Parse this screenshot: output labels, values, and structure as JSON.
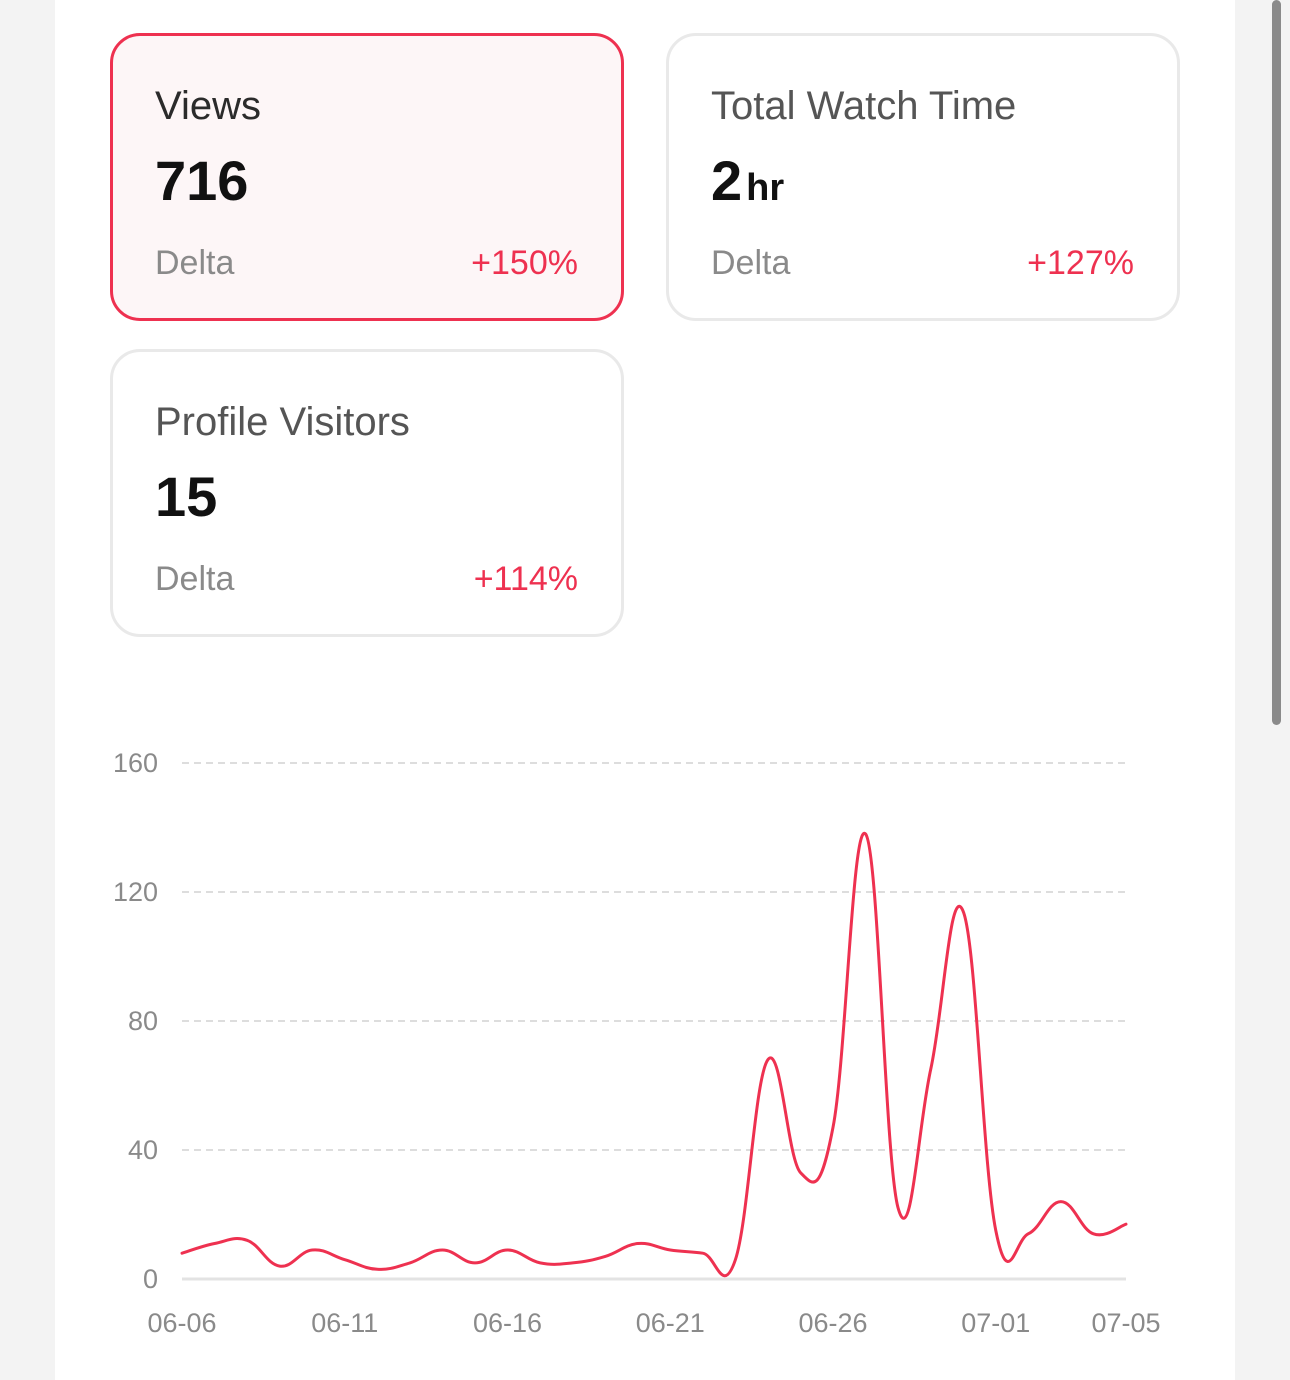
{
  "cards": [
    {
      "title": "Views",
      "value": "716",
      "unit": "",
      "delta_label": "Delta",
      "delta_value": "+150%",
      "selected": true
    },
    {
      "title": "Total Watch Time",
      "value": "2",
      "unit": "hr",
      "delta_label": "Delta",
      "delta_value": "+127%",
      "selected": false
    },
    {
      "title": "Profile Visitors",
      "value": "15",
      "unit": "",
      "delta_label": "Delta",
      "delta_value": "+114%",
      "selected": false
    }
  ],
  "colors": {
    "accent": "#ee3150",
    "grid": "#dddddd",
    "axis": "#e3e3e3",
    "tick_text": "#8a8a8a"
  },
  "chart_data": {
    "type": "line",
    "title": "",
    "xlabel": "",
    "ylabel": "",
    "ylim": [
      0,
      160
    ],
    "yticks": [
      0,
      40,
      80,
      120,
      160
    ],
    "xtick_labels": [
      "06-06",
      "06-11",
      "06-16",
      "06-21",
      "06-26",
      "07-01",
      "07-05"
    ],
    "grid": true,
    "x": [
      "06-06",
      "06-07",
      "06-08",
      "06-09",
      "06-10",
      "06-11",
      "06-12",
      "06-13",
      "06-14",
      "06-15",
      "06-16",
      "06-17",
      "06-18",
      "06-19",
      "06-20",
      "06-21",
      "06-22",
      "06-23",
      "06-24",
      "06-25",
      "06-26",
      "06-27",
      "06-28",
      "06-29",
      "06-30",
      "07-01",
      "07-02",
      "07-03",
      "07-04",
      "07-05"
    ],
    "series": [
      {
        "color": "#ee3150",
        "values": [
          8,
          11,
          12,
          4,
          9,
          6,
          3,
          5,
          9,
          5,
          9,
          5,
          5,
          7,
          11,
          9,
          8,
          6,
          68,
          33,
          47,
          138,
          22,
          65,
          114,
          15,
          14,
          24,
          14,
          17
        ]
      }
    ]
  }
}
